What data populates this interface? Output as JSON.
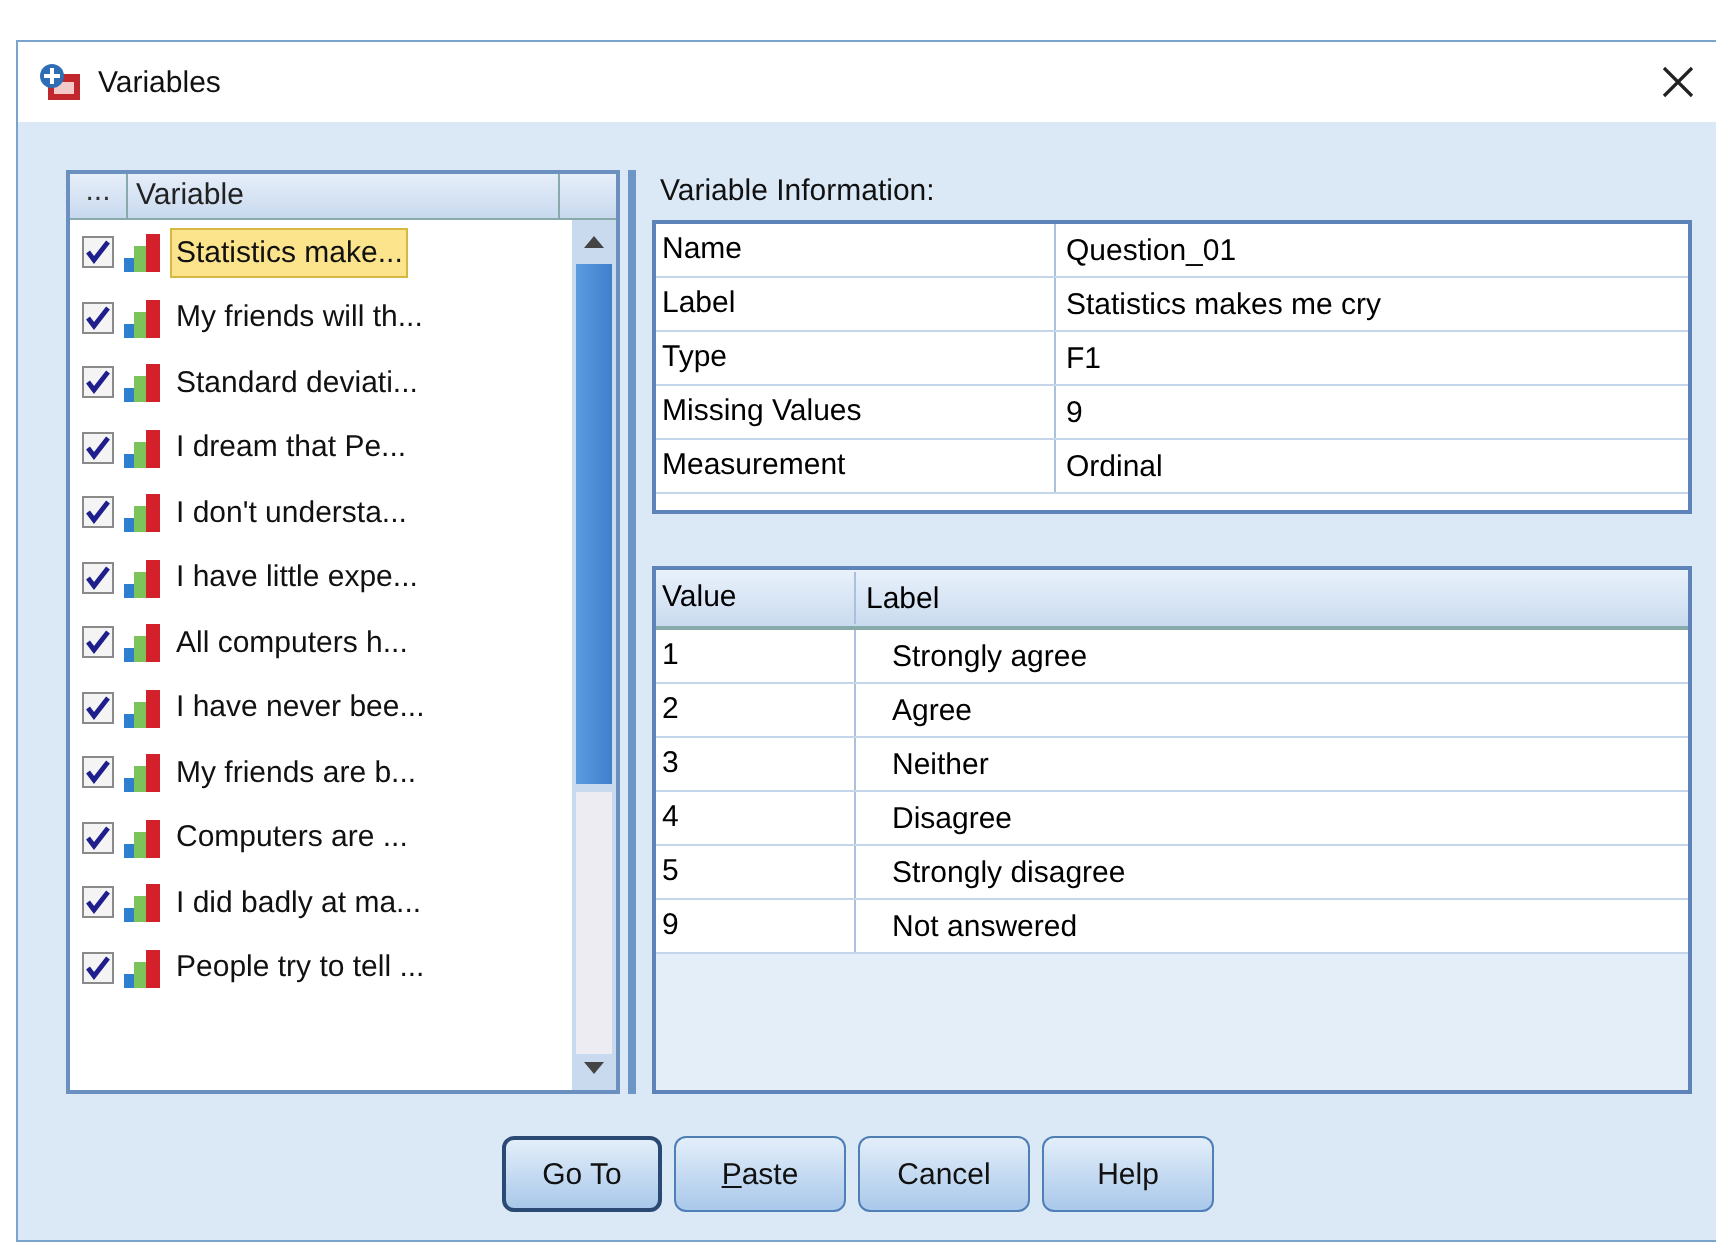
{
  "window": {
    "title": "Variables"
  },
  "variable_list": {
    "columns": [
      "...",
      "Variable"
    ],
    "items": [
      {
        "label": "Statistics make...",
        "checked": true,
        "selected": true
      },
      {
        "label": "My friends will th...",
        "checked": true,
        "selected": false
      },
      {
        "label": "Standard deviati...",
        "checked": true,
        "selected": false
      },
      {
        "label": "I dream that Pe...",
        "checked": true,
        "selected": false
      },
      {
        "label": "I don't understa...",
        "checked": true,
        "selected": false
      },
      {
        "label": "I have little expe...",
        "checked": true,
        "selected": false
      },
      {
        "label": "All computers h...",
        "checked": true,
        "selected": false
      },
      {
        "label": "I have never bee...",
        "checked": true,
        "selected": false
      },
      {
        "label": "My friends are b...",
        "checked": true,
        "selected": false
      },
      {
        "label": "Computers are ...",
        "checked": true,
        "selected": false
      },
      {
        "label": "I did badly at ma...",
        "checked": true,
        "selected": false
      },
      {
        "label": "People try to tell ...",
        "checked": true,
        "selected": false
      }
    ]
  },
  "variable_information": {
    "title": "Variable Information:",
    "rows": [
      {
        "property": "Name",
        "value": "Question_01"
      },
      {
        "property": "Label",
        "value": "Statistics makes me cry"
      },
      {
        "property": "Type",
        "value": "F1"
      },
      {
        "property": "Missing Values",
        "value": "9"
      },
      {
        "property": "Measurement",
        "value": "Ordinal"
      }
    ]
  },
  "value_labels": {
    "columns": [
      "Value",
      "Label"
    ],
    "rows": [
      {
        "value": "1",
        "label": "Strongly agree"
      },
      {
        "value": "2",
        "label": "Agree"
      },
      {
        "value": "3",
        "label": "Neither"
      },
      {
        "value": "4",
        "label": "Disagree"
      },
      {
        "value": "5",
        "label": "Strongly disagree"
      },
      {
        "value": "9",
        "label": "Not answered"
      }
    ]
  },
  "buttons": [
    {
      "label": "Go To",
      "default": true,
      "underline_first": false
    },
    {
      "label": "Paste",
      "default": false,
      "underline_first": true
    },
    {
      "label": "Cancel",
      "default": false,
      "underline_first": false
    },
    {
      "label": "Help",
      "default": false,
      "underline_first": false
    }
  ]
}
